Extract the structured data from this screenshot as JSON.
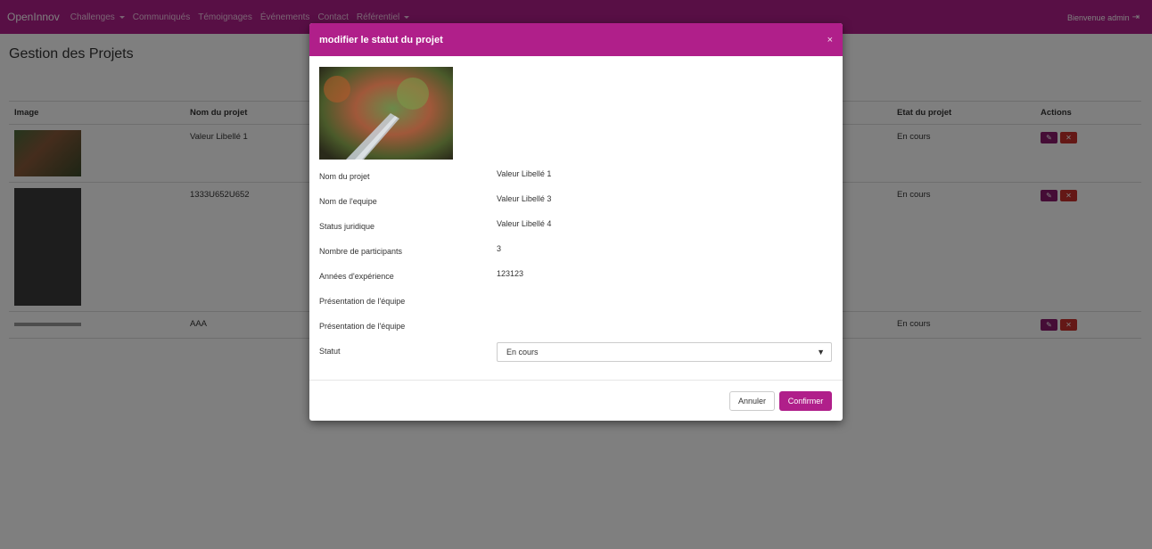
{
  "navbar": {
    "brand": "OpenInnov",
    "items": [
      "Challenges",
      "Communiqués",
      "Témoignages",
      "Événements",
      "Contact",
      "Référentiel"
    ],
    "welcome": "Bienvenue admin",
    "logout_icon": "logout-icon"
  },
  "page": {
    "title": "Gestion des Projets"
  },
  "table": {
    "columns": [
      "Image",
      "Nom du projet",
      "Etat du projet",
      "Actions"
    ],
    "rows": [
      {
        "nom": "Valeur Libellé 1",
        "etat": "En cours"
      },
      {
        "nom": "1333U652U652",
        "etat": "En cours"
      },
      {
        "nom": "AAA",
        "etat": "En cours"
      }
    ]
  },
  "modal": {
    "title": "modifier le statut du projet",
    "close_icon": "×",
    "fields": [
      {
        "label": "Nom du projet",
        "value": "Valeur Libellé 1"
      },
      {
        "label": "Nom de l'equipe",
        "value": "Valeur Libellé 3"
      },
      {
        "label": "Status juridique",
        "value": "Valeur Libellé 4"
      },
      {
        "label": "Nombre de participants",
        "value": "3"
      },
      {
        "label": "Années d'expérience",
        "value": "123123"
      },
      {
        "label": "Présentation de l'équipe",
        "value": ""
      },
      {
        "label": "Présentation de l'équipe",
        "value": ""
      }
    ],
    "statut_label": "Statut",
    "statut_value": "En cours",
    "cancel_label": "Annuler",
    "confirm_label": "Confirmer"
  },
  "colors": {
    "brand": "#b01f8a",
    "edit": "#8a1a6c",
    "delete": "#c9302c"
  }
}
